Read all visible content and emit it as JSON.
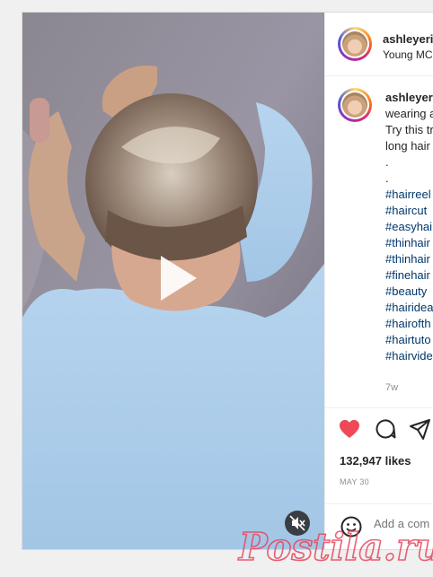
{
  "post": {
    "author": {
      "username": "ashleyeri",
      "audio": "Young MC"
    },
    "caption": {
      "username": "ashleyeri",
      "lines": [
        "wearing a",
        "Try this tr",
        "long hair",
        ".",
        "."
      ],
      "hashtags": [
        "#hairreel",
        "#haircut",
        "#easyhai",
        "#thinhair",
        "#thinhair",
        "#finehair",
        "#beauty",
        "#hairidea",
        "#hairofth",
        "#hairtuto",
        "#hairvide"
      ],
      "time": "7w"
    },
    "likes": "132,947 likes",
    "date": "MAY 30",
    "comment_placeholder": "Add a com",
    "icons": {
      "play": "play-icon",
      "mute": "muted-speaker-icon",
      "like": "heart-icon",
      "comment": "comment-bubble-icon",
      "share": "paper-plane-icon",
      "emoji": "smiley-icon"
    },
    "colors": {
      "like": "#ed4956",
      "hashtag": "#00376b",
      "watermark": "#e6465c"
    }
  },
  "watermark": {
    "text": "Postila.ru"
  }
}
